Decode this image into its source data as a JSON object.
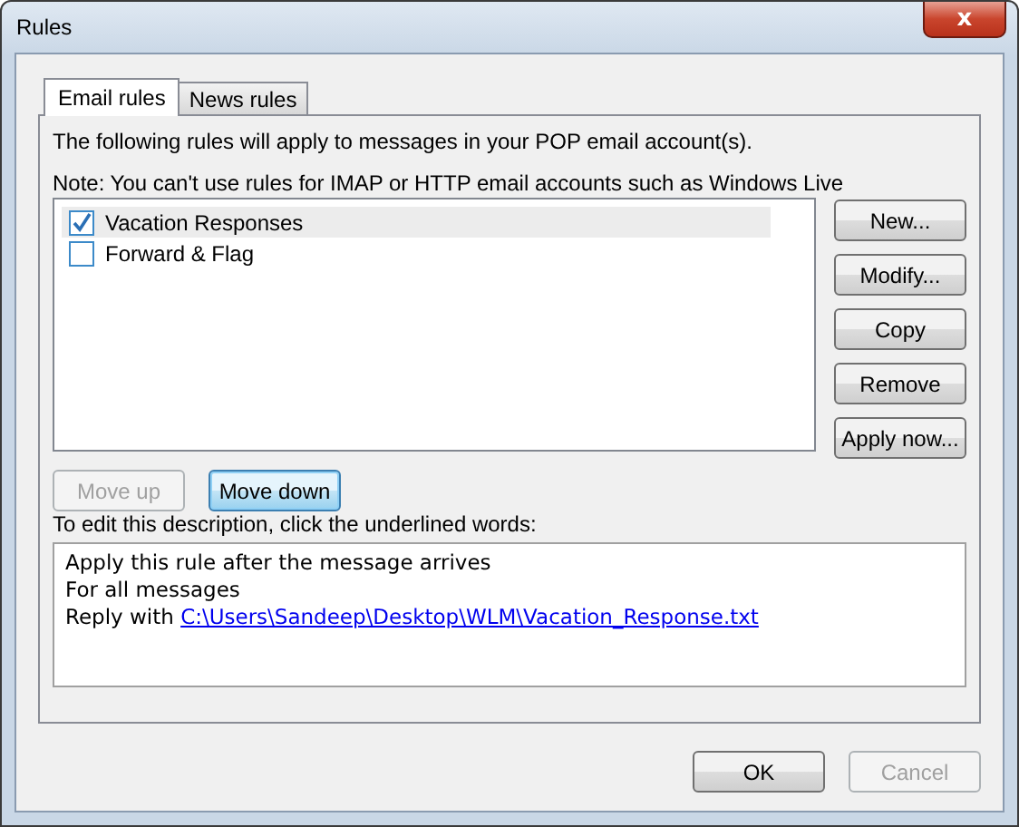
{
  "window": {
    "title": "Rules",
    "close_icon": "x"
  },
  "tabs": [
    {
      "label": "Email rules",
      "selected": true
    },
    {
      "label": "News rules",
      "selected": false
    }
  ],
  "intro": "The following rules will apply to messages in your POP email account(s).",
  "note": "Note: You can't use rules for IMAP or HTTP email accounts such as Windows Live",
  "rules": [
    {
      "name": "Vacation Responses",
      "checked": true,
      "selected": true
    },
    {
      "name": "Forward & Flag",
      "checked": false,
      "selected": false
    }
  ],
  "side_buttons": [
    {
      "label": "New..."
    },
    {
      "label": "Modify..."
    },
    {
      "label": "Copy"
    },
    {
      "label": "Remove"
    },
    {
      "label": "Apply now..."
    }
  ],
  "move_buttons": [
    {
      "label": "Move up",
      "disabled": true,
      "focused": false
    },
    {
      "label": "Move down",
      "disabled": false,
      "focused": true
    }
  ],
  "description_label": "To edit this description, click the underlined words:",
  "description": [
    {
      "text": "Apply this rule after the message arrives"
    },
    {
      "text": "For all messages"
    },
    {
      "text": "Reply with ",
      "link": "C:\\Users\\Sandeep\\Desktop\\WLM\\Vacation_Response.txt"
    }
  ],
  "footer_buttons": [
    {
      "label": "OK",
      "disabled": false
    },
    {
      "label": "Cancel",
      "disabled": true
    }
  ]
}
